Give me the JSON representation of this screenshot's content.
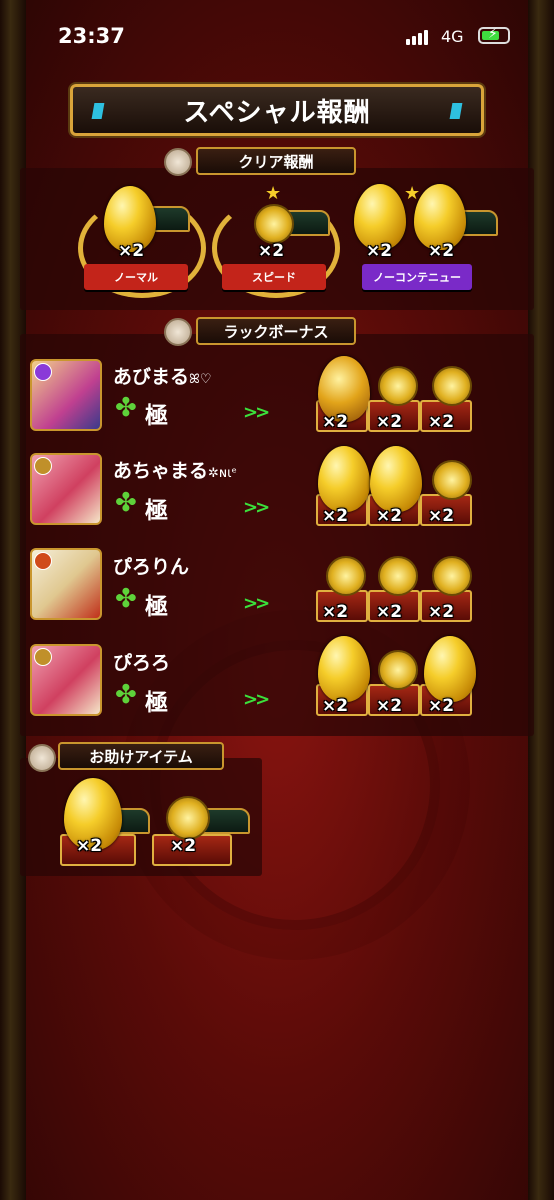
{
  "status_bar": {
    "time": "23:37",
    "network": "4G"
  },
  "title": "スペシャル報酬",
  "clear_rewards": {
    "label": "クリア報酬",
    "items": [
      {
        "ribbon": "ノーマル",
        "multiplier": "×2",
        "ribbon_color": "#c3241a"
      },
      {
        "ribbon": "スピード",
        "multiplier": "×2",
        "ribbon_color": "#c3241a"
      },
      {
        "ribbon": "ノーコンテニュー",
        "multipliers": [
          "×2",
          "×2"
        ],
        "ribbon_color": "#7a2ac8"
      }
    ]
  },
  "luck_bonus": {
    "label": "ラックボーナス",
    "players": [
      {
        "name": "あびまる",
        "suffix": "ꕤ♡",
        "grade": "極",
        "rewards": [
          "×2",
          "×2",
          "×2"
        ]
      },
      {
        "name": "あちゃまる",
        "suffix": "✲ɴɩᵉ",
        "grade": "極",
        "rewards": [
          "×2",
          "×2",
          "×2"
        ]
      },
      {
        "name": "ぴろりん",
        "suffix": "",
        "grade": "極",
        "rewards": [
          "×2",
          "×2",
          "×2"
        ]
      },
      {
        "name": "ぴろろ",
        "suffix": "",
        "grade": "極",
        "rewards": [
          "×2",
          "×2",
          "×2"
        ]
      }
    ]
  },
  "help_items": {
    "label": "お助けアイテム",
    "rewards": [
      "×2",
      "×2"
    ]
  },
  "colors": {
    "gold": "#c9962e",
    "panel": "#2a0606",
    "clover": "#5ed23a",
    "arrow": "#3be03b"
  },
  "icons": [
    "rose-medal-icon",
    "golden-egg-icon",
    "gold-medal-icon",
    "treasure-chest-icon",
    "clover-icon",
    "double-arrow-icon"
  ]
}
